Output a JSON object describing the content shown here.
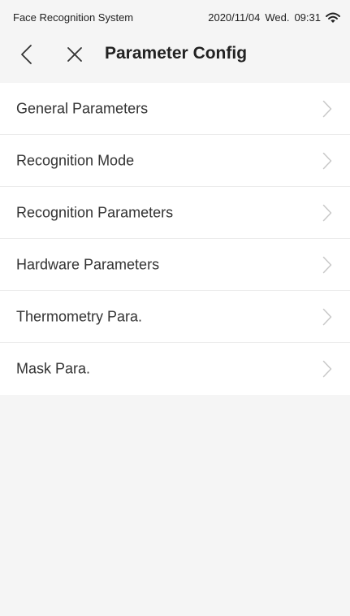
{
  "status_bar": {
    "app_name": "Face Recognition System",
    "date": "2020/11/04",
    "weekday": "Wed.",
    "time": "09:31",
    "wifi_icon": "wifi-icon"
  },
  "nav": {
    "back_icon": "back-icon",
    "close_icon": "close-icon",
    "title": "Parameter Config"
  },
  "menu": {
    "items": [
      {
        "label": "General Parameters",
        "icon": "chevron-right-icon"
      },
      {
        "label": "Recognition Mode",
        "icon": "chevron-right-icon"
      },
      {
        "label": "Recognition Parameters",
        "icon": "chevron-right-icon"
      },
      {
        "label": "Hardware Parameters",
        "icon": "chevron-right-icon"
      },
      {
        "label": "Thermometry Para.",
        "icon": "chevron-right-icon"
      },
      {
        "label": "Mask Para.",
        "icon": "chevron-right-icon"
      }
    ]
  },
  "colors": {
    "background": "#f5f5f5",
    "list_background": "#ffffff",
    "divider": "#ececec",
    "text": "#333333",
    "chevron": "#c8c8c8"
  }
}
